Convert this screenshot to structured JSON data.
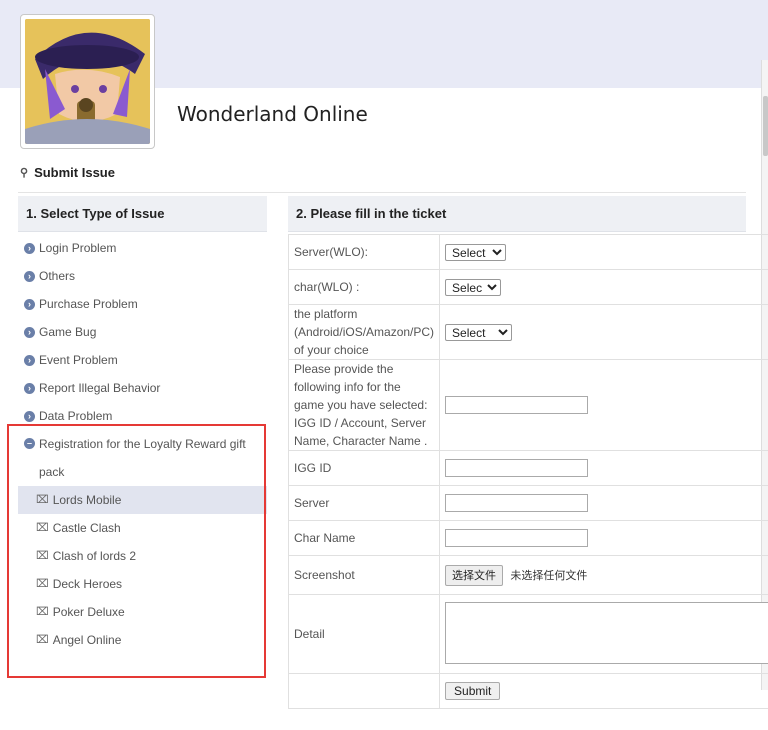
{
  "app": {
    "title": "Wonderland Online"
  },
  "submit_issue": {
    "heading": "Submit Issue"
  },
  "left_panel": {
    "header": "1. Select Type of Issue",
    "items": [
      {
        "label": "Login Problem"
      },
      {
        "label": "Others"
      },
      {
        "label": "Purchase Problem"
      },
      {
        "label": "Game Bug"
      },
      {
        "label": "Event Problem"
      },
      {
        "label": "Report Illegal Behavior"
      },
      {
        "label": "Data Problem"
      },
      {
        "label": "Registration for the Loyalty Reward gift pack"
      }
    ],
    "sub_items": [
      {
        "label": "Lords Mobile"
      },
      {
        "label": "Castle Clash"
      },
      {
        "label": "Clash of lords 2"
      },
      {
        "label": "Deck Heroes"
      },
      {
        "label": "Poker Deluxe"
      },
      {
        "label": "Angel Online"
      }
    ]
  },
  "right_panel": {
    "header": "2. Please fill in the ticket",
    "rows": {
      "server": {
        "label": "Server(WLO):",
        "value": "Select"
      },
      "char": {
        "label": "char(WLO) :",
        "value": "Select"
      },
      "platform": {
        "label": "the platform (Android/iOS/Amazon/PC) of your choice",
        "value": "Select"
      },
      "info": {
        "label": "Please provide the following info for the game you have selected: IGG ID / Account, Server Name, Character Name ."
      },
      "igg_id": {
        "label": "IGG ID"
      },
      "server_name": {
        "label": "Server"
      },
      "char_name": {
        "label": "Char Name"
      },
      "screenshot": {
        "label": "Screenshot",
        "button": "选择文件",
        "status": "未选择任何文件"
      },
      "detail": {
        "label": "Detail"
      }
    },
    "submit_label": "Submit"
  },
  "colors": {
    "top_band": "#e8eaf6",
    "header_bg": "#eef0f4",
    "highlight_border": "#e53935",
    "active_item": "#e1e4ef",
    "bullet": "#6a7fa8"
  },
  "icons": {
    "bullet": "circle-arrow-icon",
    "sub_bullet": "tag-icon",
    "heading": "pin-icon"
  }
}
